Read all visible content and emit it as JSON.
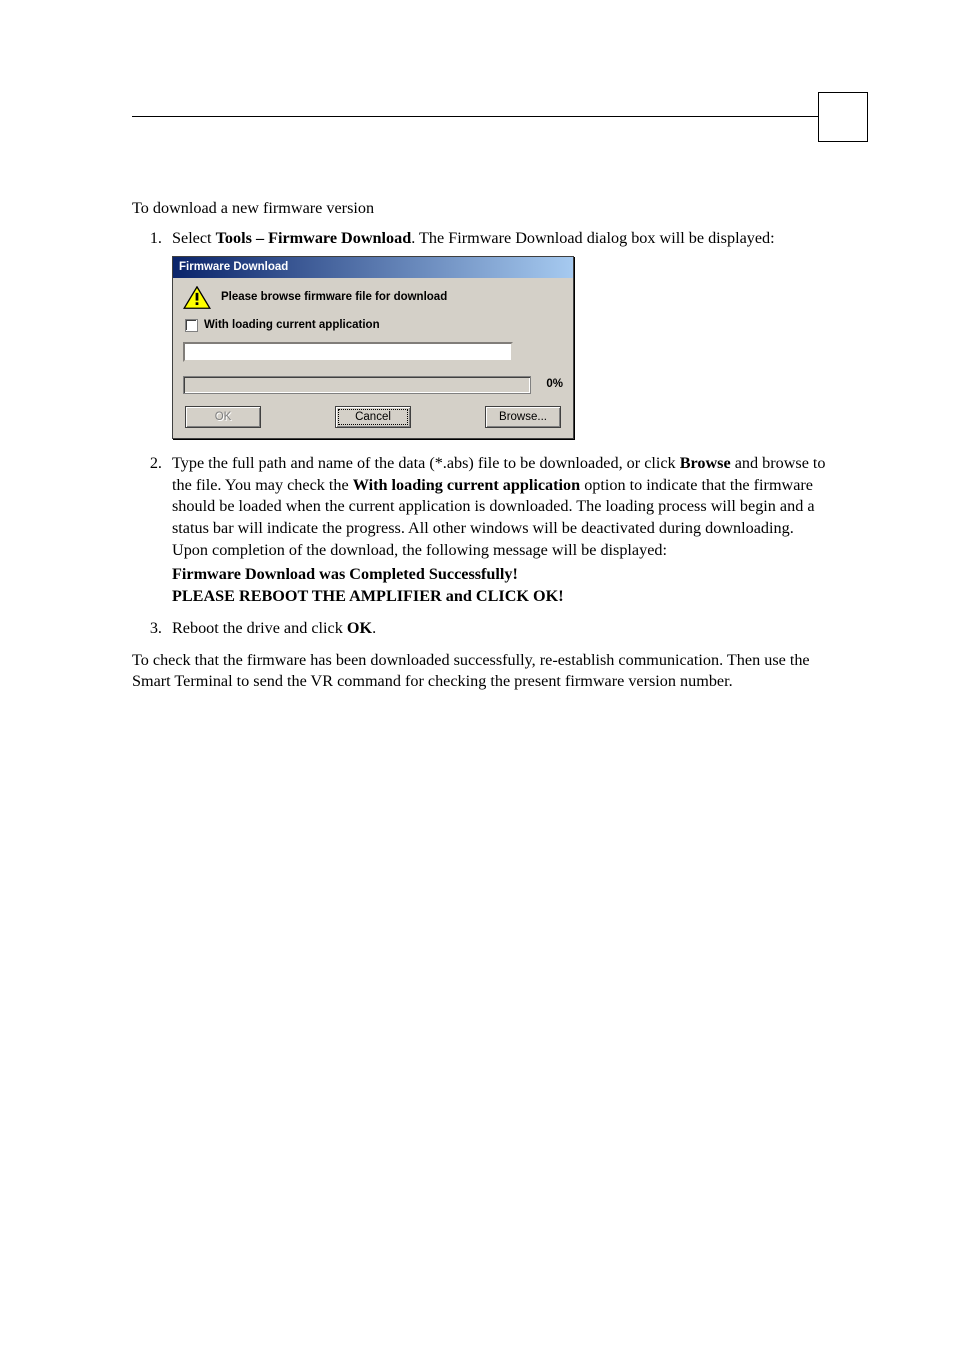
{
  "intro": "To download a new firmware version",
  "steps": {
    "s1_a": "Select ",
    "s1_bold": "Tools – Firmware Download",
    "s1_b": ". The Firmware Download dialog box will be displayed:",
    "s2_a": "Type the full path and name of the data (*.abs) file to be downloaded, or click ",
    "s2_browse": "Browse",
    "s2_b": " and browse to the file. You may check the ",
    "s2_withload": "With loading current application",
    "s2_c": " option to indicate that the firmware should be loaded when the current application is downloaded. The loading process will begin and a status bar will indicate the progress. All other windows will be deactivated during downloading. Upon completion of the download, the following message will be displayed:",
    "s2_msg1": "Firmware Download was Completed Successfully!",
    "s2_msg2": "PLEASE REBOOT THE AMPLIFIER and CLICK OK!",
    "s3_a": "Reboot the drive and click ",
    "s3_ok": "OK",
    "s3_b": "."
  },
  "closing": "To check that the firmware has been downloaded successfully, re-establish communication. Then use the Smart Terminal to send the VR command for checking the present firmware version number.",
  "dialog": {
    "title": "Firmware Download",
    "message": "Please browse firmware file for download",
    "checkbox_label": "With loading current application",
    "progress_pct": "0%",
    "buttons": {
      "ok": "OK",
      "cancel": "Cancel",
      "browse": "Browse..."
    }
  }
}
